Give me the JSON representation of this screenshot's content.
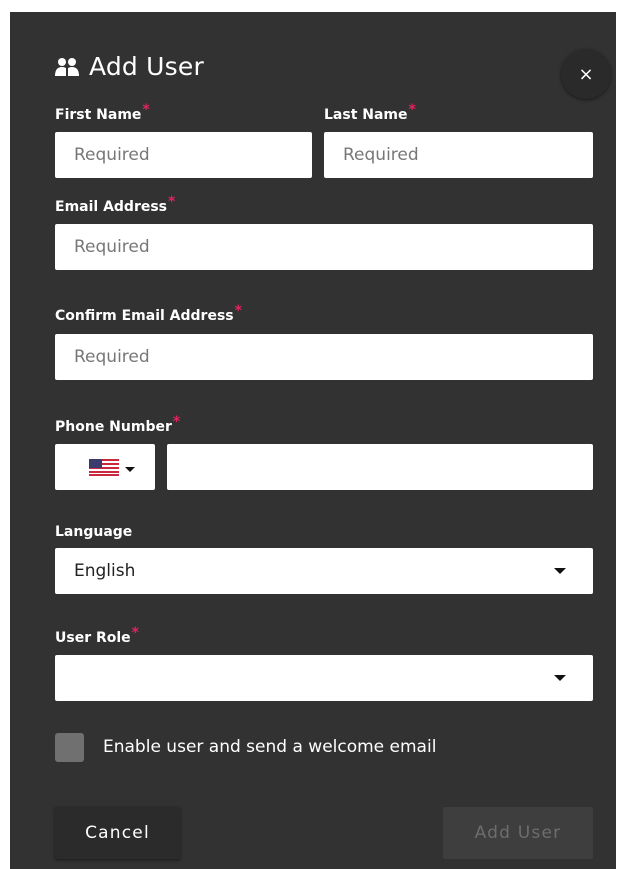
{
  "dialog": {
    "title": "Add User",
    "close_label": "×"
  },
  "form": {
    "required_marker": "*",
    "first_name": {
      "label": "First Name",
      "placeholder": "Required"
    },
    "last_name": {
      "label": "Last Name",
      "placeholder": "Required"
    },
    "email": {
      "label": "Email Address",
      "placeholder": "Required"
    },
    "confirm_email": {
      "label": "Confirm Email Address",
      "placeholder": "Required"
    },
    "phone": {
      "label": "Phone Number",
      "country": "US",
      "value": ""
    },
    "language": {
      "label": "Language",
      "value": "English"
    },
    "user_role": {
      "label": "User Role",
      "value": ""
    },
    "welcome_checkbox": {
      "label": "Enable user and send a welcome email",
      "checked": false
    }
  },
  "actions": {
    "cancel_label": "Cancel",
    "submit_label": "Add User"
  },
  "colors": {
    "dialog_bg": "#323232",
    "required": "#e0245e",
    "field_bg": "#ffffff",
    "disabled_text": "#6d6d6d"
  }
}
